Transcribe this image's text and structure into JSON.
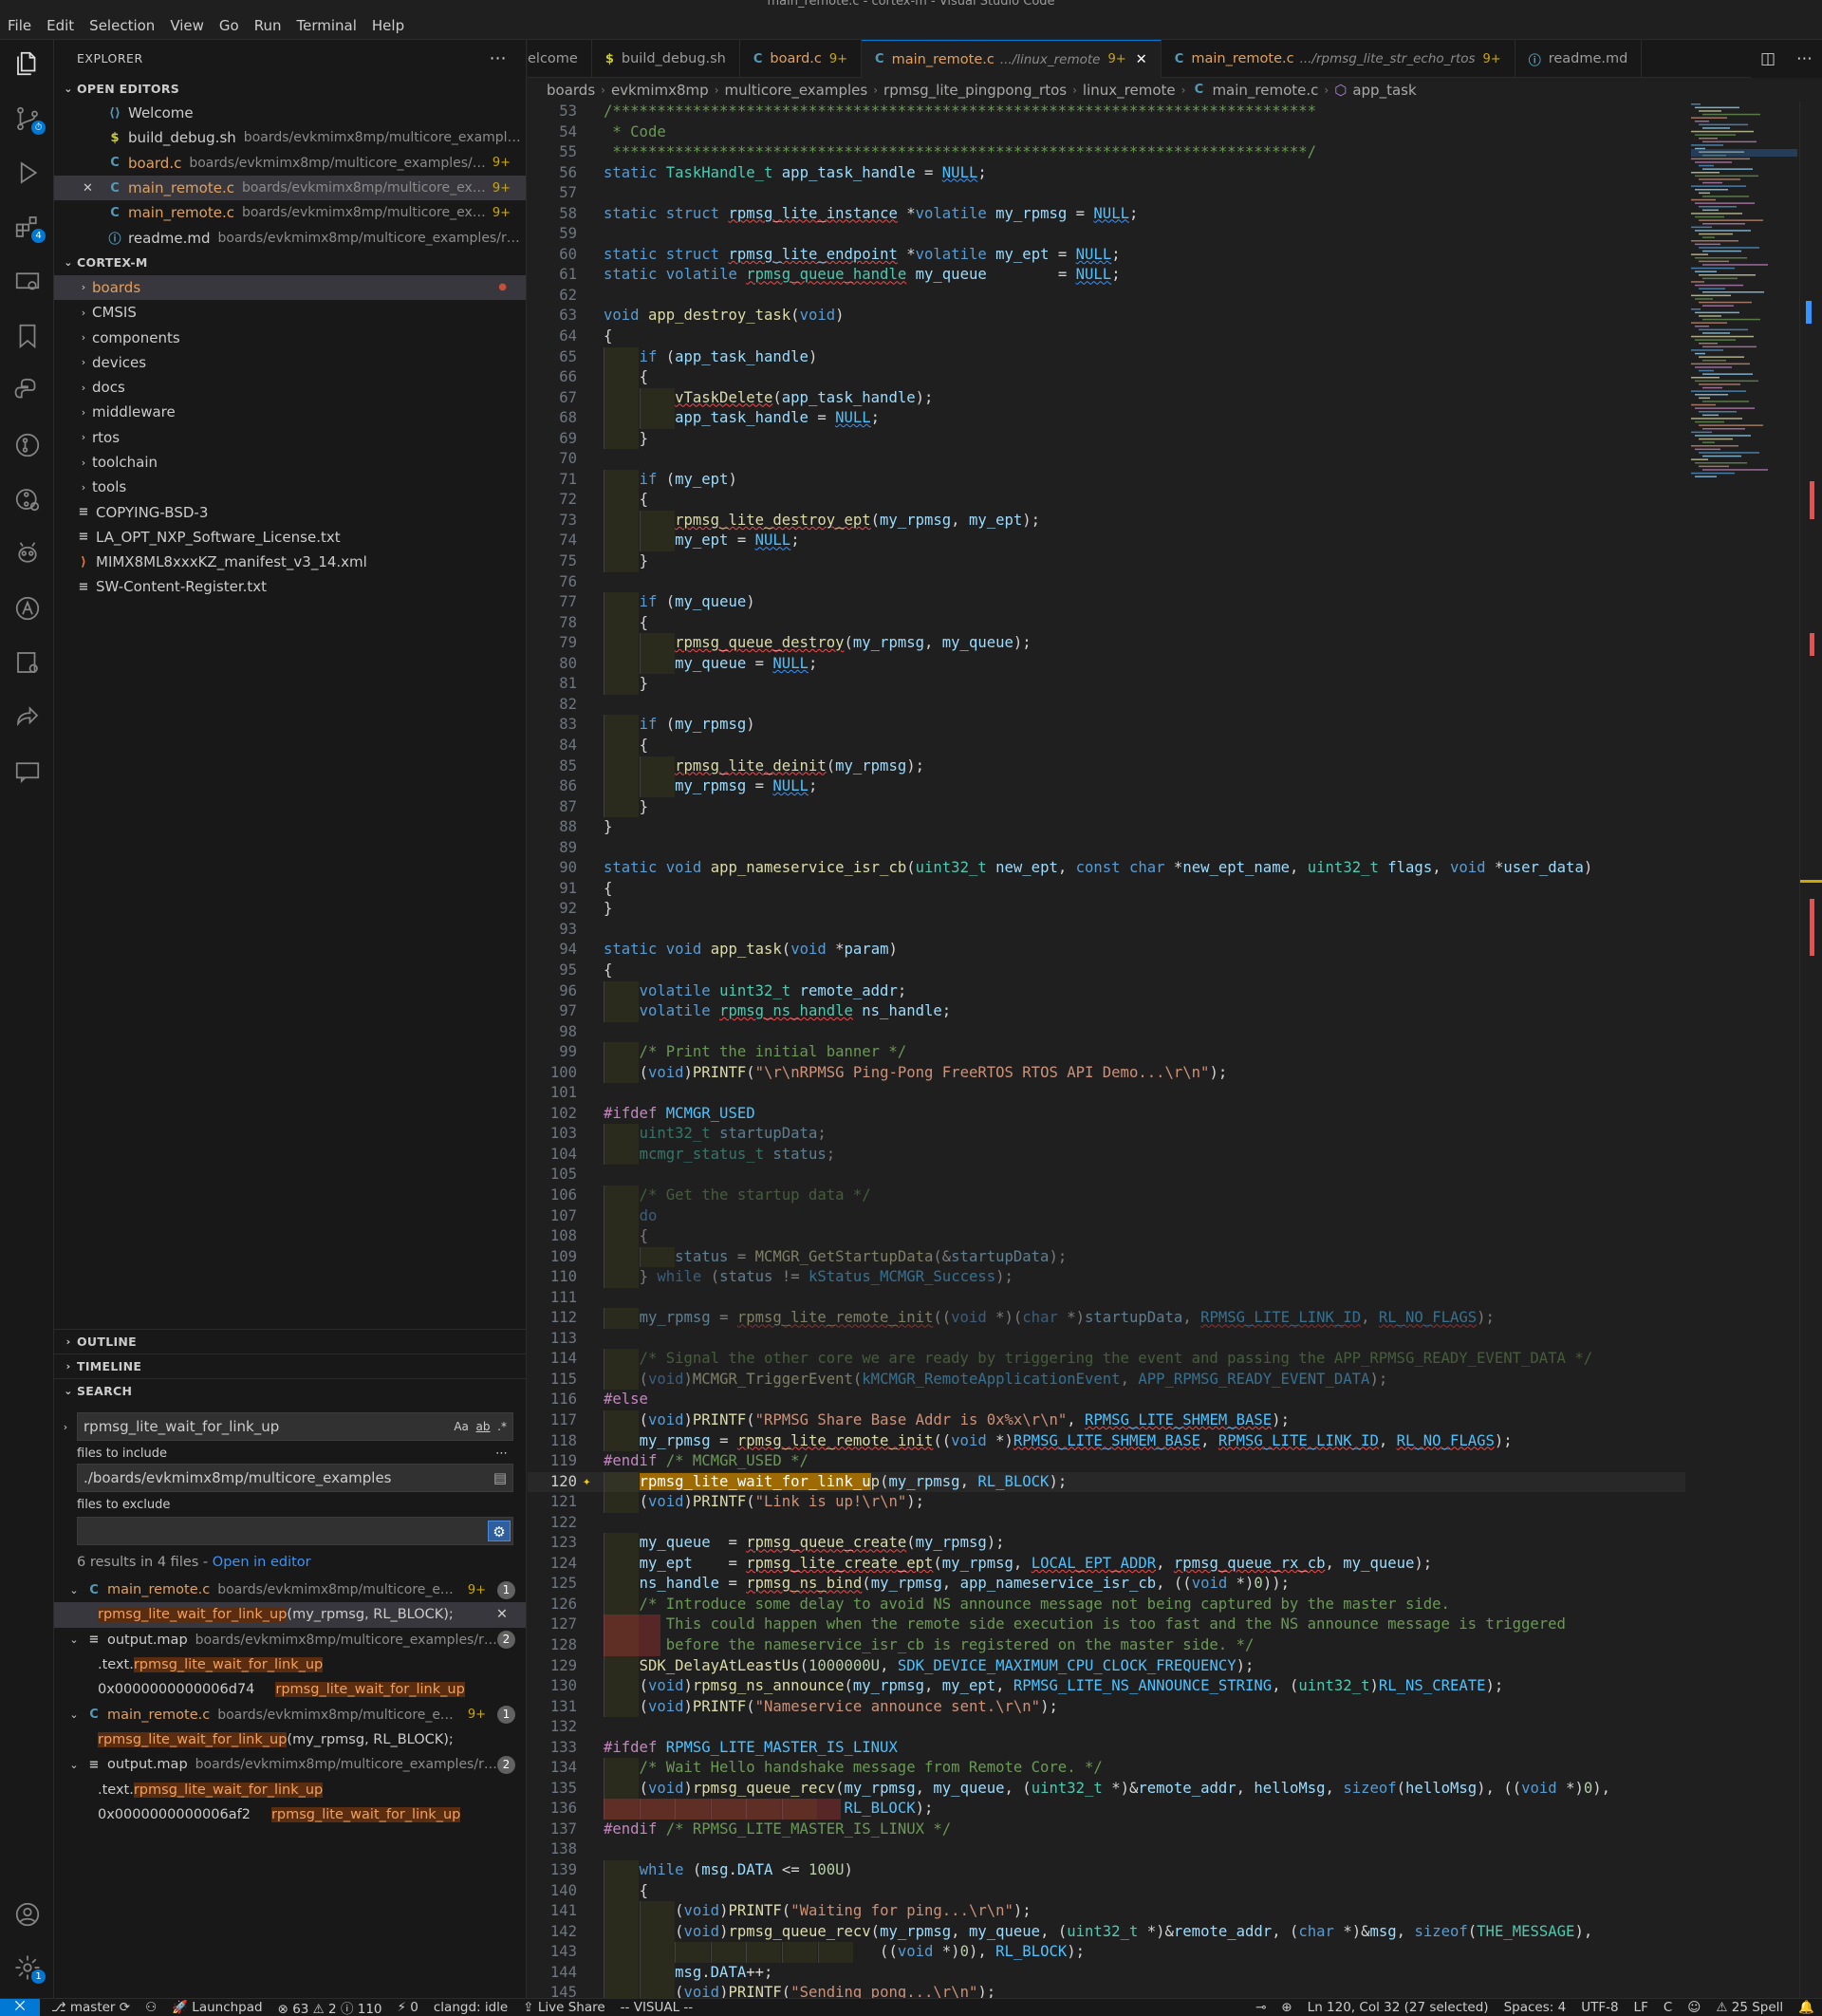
{
  "window": {
    "title": "main_remote.c - cortex-m - Visual Studio Code"
  },
  "menu": [
    "File",
    "Edit",
    "Selection",
    "View",
    "Go",
    "Run",
    "Terminal",
    "Help"
  ],
  "explorer": {
    "title": "EXPLORER",
    "open_editors_label": "OPEN EDITORS",
    "open_editors": [
      {
        "name": "Welcome",
        "path": "",
        "count": "",
        "icon": "vscode"
      },
      {
        "name": "build_debug.sh",
        "path": "boards/evkmimx8mp/multicore_examples/rp...",
        "count": "",
        "icon": "shell"
      },
      {
        "name": "board.c",
        "path": "boards/evkmimx8mp/multicore_examples/rpms...",
        "count": "9+",
        "icon": "c"
      },
      {
        "name": "main_remote.c",
        "path": "boards/evkmimx8mp/multicore_exampl...",
        "count": "9+",
        "icon": "c"
      },
      {
        "name": "main_remote.c",
        "path": "boards/evkmimx8mp/multicore_exampl...",
        "count": "9+",
        "icon": "c"
      },
      {
        "name": "readme.md",
        "path": "boards/evkmimx8mp/multicore_examples/rpmsg...",
        "count": "",
        "icon": "info"
      }
    ],
    "workspace_label": "CORTEX-M",
    "tree": [
      {
        "name": "boards",
        "folder": true
      },
      {
        "name": "CMSIS",
        "folder": true
      },
      {
        "name": "components",
        "folder": true
      },
      {
        "name": "devices",
        "folder": true
      },
      {
        "name": "docs",
        "folder": true
      },
      {
        "name": "middleware",
        "folder": true
      },
      {
        "name": "rtos",
        "folder": true
      },
      {
        "name": "toolchain",
        "folder": true
      },
      {
        "name": "tools",
        "folder": true
      },
      {
        "name": "COPYING-BSD-3",
        "folder": false
      },
      {
        "name": "LA_OPT_NXP_Software_License.txt",
        "folder": false
      },
      {
        "name": "MIMX8ML8xxxKZ_manifest_v3_14.xml",
        "folder": false
      },
      {
        "name": "SW-Content-Register.txt",
        "folder": false
      }
    ],
    "outline_label": "OUTLINE",
    "timeline_label": "TIMELINE"
  },
  "search": {
    "label": "SEARCH",
    "query": "rpmsg_lite_wait_for_link_up",
    "opt_case": "Aa",
    "opt_word": "ab",
    "opt_regex": ".*",
    "include_label": "files to include",
    "include_value": "./boards/evkmimx8mp/multicore_examples",
    "exclude_label": "files to exclude",
    "summary": "6 results in 4 files - ",
    "open_in_editor": "Open in editor",
    "results": [
      {
        "file": "main_remote.c",
        "path": "boards/evkmimx8mp/multicore_exa...",
        "count": "9+",
        "n": "1",
        "icon": "C",
        "lines": [
          {
            "pre": "",
            "hit": "rpmsg_lite_wait_for_link_up",
            "post": "(my_rpmsg, RL_BLOCK);",
            "sel": true
          }
        ]
      },
      {
        "file": "output.map",
        "path": "boards/evkmimx8mp/multicore_examples/rp...",
        "count": "",
        "n": "2",
        "icon": "≡",
        "lines": [
          {
            "pre": ".text.",
            "hit": "rpmsg_lite_wait_for_link_up",
            "post": ""
          },
          {
            "pre": "0x0000000000006d74",
            "hit": "rpmsg_lite_wait_for_link_up",
            "post": "",
            "gap": true
          }
        ]
      },
      {
        "file": "main_remote.c",
        "path": "boards/evkmimx8mp/multicore_exa...",
        "count": "9+",
        "n": "1",
        "icon": "C",
        "lines": [
          {
            "pre": "",
            "hit": "rpmsg_lite_wait_for_link_up",
            "post": "(my_rpmsg, RL_BLOCK);"
          }
        ]
      },
      {
        "file": "output.map",
        "path": "boards/evkmimx8mp/multicore_examples/rp...",
        "count": "",
        "n": "2",
        "icon": "≡",
        "lines": [
          {
            "pre": ".text.",
            "hit": "rpmsg_lite_wait_for_link_up",
            "post": ""
          },
          {
            "pre": "0x0000000000006af2",
            "hit": "rpmsg_lite_wait_for_link_up",
            "post": "",
            "gap": true
          }
        ]
      }
    ]
  },
  "tabs": [
    {
      "label": "Welcome",
      "display": "elcome",
      "sub": "",
      "count": "",
      "icon": ""
    },
    {
      "label": "build_debug.sh",
      "sub": "",
      "count": "",
      "icon": "$"
    },
    {
      "label": "board.c",
      "sub": "",
      "count": "9+",
      "icon": "C"
    },
    {
      "label": "main_remote.c",
      "sub": ".../linux_remote",
      "count": "9+",
      "icon": "C",
      "active": true
    },
    {
      "label": "main_remote.c",
      "sub": ".../rpmsg_lite_str_echo_rtos",
      "count": "9+",
      "icon": "C"
    },
    {
      "label": "readme.md",
      "sub": "",
      "count": "",
      "icon": "ⓘ"
    }
  ],
  "breadcrumbs": [
    "boards",
    "evkmimx8mp",
    "multicore_examples",
    "rpmsg_lite_pingpong_rtos",
    "linux_remote",
    "main_remote.c",
    "app_task"
  ],
  "code": {
    "first_line": 53,
    "current_line": 120,
    "lines": [
      "/*******************************************************************************",
      " * Code",
      " ******************************************************************************/",
      "static TaskHandle_t app_task_handle = NULL;",
      "",
      "static struct rpmsg_lite_instance *volatile my_rpmsg = NULL;",
      "",
      "static struct rpmsg_lite_endpoint *volatile my_ept = NULL;",
      "static volatile rpmsg_queue_handle my_queue        = NULL;",
      "",
      "void app_destroy_task(void)",
      "{",
      "    if (app_task_handle)",
      "    {",
      "        vTaskDelete(app_task_handle);",
      "        app_task_handle = NULL;",
      "    }",
      "",
      "    if (my_ept)",
      "    {",
      "        rpmsg_lite_destroy_ept(my_rpmsg, my_ept);",
      "        my_ept = NULL;",
      "    }",
      "",
      "    if (my_queue)",
      "    {",
      "        rpmsg_queue_destroy(my_rpmsg, my_queue);",
      "        my_queue = NULL;",
      "    }",
      "",
      "    if (my_rpmsg)",
      "    {",
      "        rpmsg_lite_deinit(my_rpmsg);",
      "        my_rpmsg = NULL;",
      "    }",
      "}",
      "",
      "static void app_nameservice_isr_cb(uint32_t new_ept, const char *new_ept_name, uint32_t flags, void *user_data)",
      "{",
      "}",
      "",
      "static void app_task(void *param)",
      "{",
      "    volatile uint32_t remote_addr;",
      "    volatile rpmsg_ns_handle ns_handle;",
      "",
      "    /* Print the initial banner */",
      "    (void)PRINTF(\"\\r\\nRPMSG Ping-Pong FreeRTOS RTOS API Demo...\\r\\n\");",
      "",
      "#ifdef MCMGR_USED",
      "    uint32_t startupData;",
      "    mcmgr_status_t status;",
      "",
      "    /* Get the startup data */",
      "    do",
      "    {",
      "        status = MCMGR_GetStartupData(&startupData);",
      "    } while (status != kStatus_MCMGR_Success);",
      "",
      "    my_rpmsg = rpmsg_lite_remote_init((void *)(char *)startupData, RPMSG_LITE_LINK_ID, RL_NO_FLAGS);",
      "",
      "    /* Signal the other core we are ready by triggering the event and passing the APP_RPMSG_READY_EVENT_DATA */",
      "    (void)MCMGR_TriggerEvent(kMCMGR_RemoteApplicationEvent, APP_RPMSG_READY_EVENT_DATA);",
      "#else",
      "    (void)PRINTF(\"RPMSG Share Base Addr is 0x%x\\r\\n\", RPMSG_LITE_SHMEM_BASE);",
      "    my_rpmsg = rpmsg_lite_remote_init((void *)RPMSG_LITE_SHMEM_BASE, RPMSG_LITE_LINK_ID, RL_NO_FLAGS);",
      "#endif /* MCMGR_USED */",
      "    rpmsg_lite_wait_for_link_up(my_rpmsg, RL_BLOCK);",
      "    (void)PRINTF(\"Link is up!\\r\\n\");",
      "",
      "    my_queue  = rpmsg_queue_create(my_rpmsg);",
      "    my_ept    = rpmsg_lite_create_ept(my_rpmsg, LOCAL_EPT_ADDR, rpmsg_queue_rx_cb, my_queue);",
      "    ns_handle = rpmsg_ns_bind(my_rpmsg, app_nameservice_isr_cb, ((void *)0));",
      "    /* Introduce some delay to avoid NS announce message not being captured by the master side.",
      "       This could happen when the remote side execution is too fast and the NS announce message is triggered",
      "       before the nameservice_isr_cb is registered on the master side. */",
      "    SDK_DelayAtLeastUs(1000000U, SDK_DEVICE_MAXIMUM_CPU_CLOCK_FREQUENCY);",
      "    (void)rpmsg_ns_announce(my_rpmsg, my_ept, RPMSG_LITE_NS_ANNOUNCE_STRING, (uint32_t)RL_NS_CREATE);",
      "    (void)PRINTF(\"Nameservice announce sent.\\r\\n\");",
      "",
      "#ifdef RPMSG_LITE_MASTER_IS_LINUX",
      "    /* Wait Hello handshake message from Remote Core. */",
      "    (void)rpmsg_queue_recv(my_rpmsg, my_queue, (uint32_t *)&remote_addr, helloMsg, sizeof(helloMsg), ((void *)0),",
      "                           RL_BLOCK);",
      "#endif /* RPMSG_LITE_MASTER_IS_LINUX */",
      "",
      "    while (msg.DATA <= 100U)",
      "    {",
      "        (void)PRINTF(\"Waiting for ping...\\r\\n\");",
      "        (void)rpmsg_queue_recv(my_rpmsg, my_queue, (uint32_t *)&remote_addr, (char *)&msg, sizeof(THE_MESSAGE),",
      "                               ((void *)0), RL_BLOCK);",
      "        msg.DATA++;",
      "        (void)PRINTF(\"Sending pong...\\r\\n\");"
    ]
  },
  "status": {
    "branch": "master",
    "launchpad": "Launchpad",
    "problems": "⊗ 63 ⚠ 2 ⓘ 110",
    "ports": "0",
    "clangd": "clangd: idle",
    "liveshare": "Live Share",
    "mode": "-- VISUAL --",
    "position": "Ln 120, Col 32 (27 selected)",
    "spaces": "Spaces: 4",
    "encoding": "UTF-8",
    "eol": "LF",
    "language": "C",
    "spell": "25 Spell"
  },
  "colors": {
    "accent": "#0078d4",
    "warning": "#cca700",
    "error": "#f14c4c",
    "selection_hit": "#9e6a03"
  }
}
